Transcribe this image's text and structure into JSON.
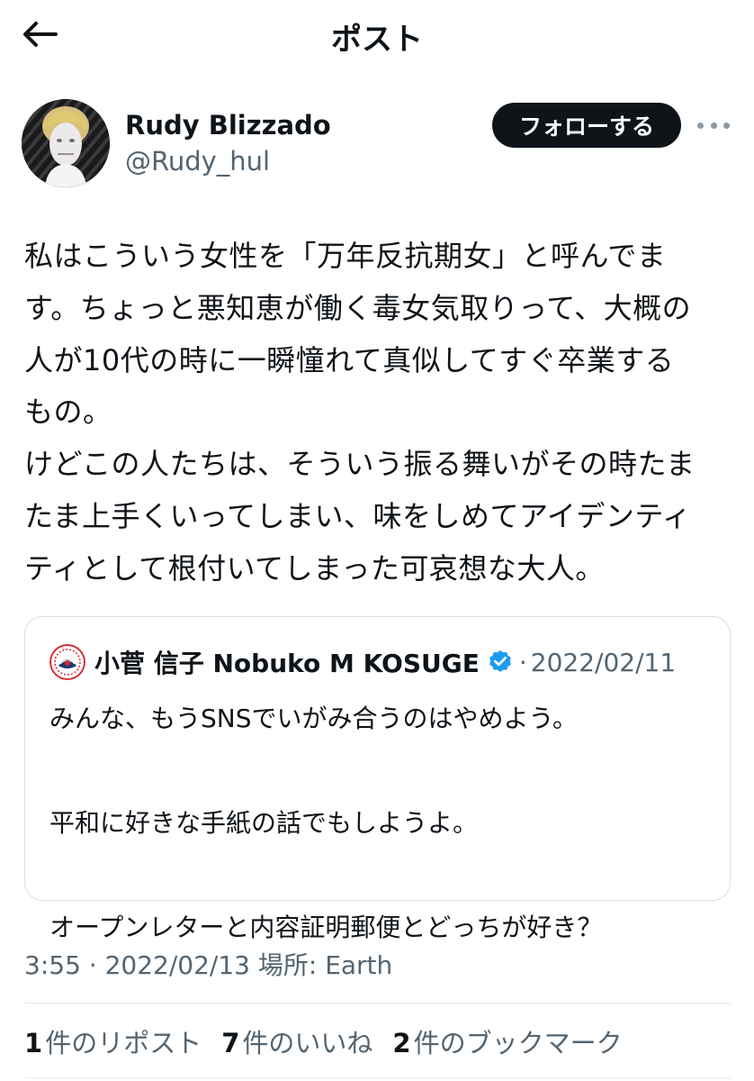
{
  "header": {
    "title": "ポスト",
    "back_icon": "arrow-left-icon"
  },
  "author": {
    "display_name": "Rudy Blizzado",
    "handle": "@Rudy_hul",
    "follow_label": "フォローする",
    "more_icon": "more-horizontal-icon"
  },
  "post": {
    "text": "私はこういう女性を「万年反抗期女」と呼んでま\nす。ちょっと悪知恵が働く毒女気取りって、大概の\n人が10代の時に一瞬憧れて真似してすぐ卒業する\nもの。\nけどこの人たちは、そういう振る舞いがその時たま\nたま上手くいってしまい、味をしめてアイデンティ\nティとして根付いてしまった可哀想な大人。"
  },
  "quote": {
    "name": "小菅 信子 Nobuko M KOSUGE",
    "separator": "·",
    "date": "2022/02/11",
    "verified_icon": "verified-badge-icon",
    "text": "みんな、もうSNSでいがみ合うのはやめよう。\n\n平和に好きな手紙の話でもしようよ。\n\nオープンレターと内容証明郵便とどっちが好き？"
  },
  "meta": {
    "text": "3:55 · 2022/02/13 場所: Earth"
  },
  "stats": [
    {
      "count": "1",
      "label": "件のリポスト"
    },
    {
      "count": "7",
      "label": "件のいいね"
    },
    {
      "count": "2",
      "label": "件のブックマーク"
    }
  ],
  "colors": {
    "text": "#0f1419",
    "secondary": "#536471",
    "button_bg": "#0f1419",
    "verified": "#1d9bf0",
    "border": "#d6dee3"
  }
}
